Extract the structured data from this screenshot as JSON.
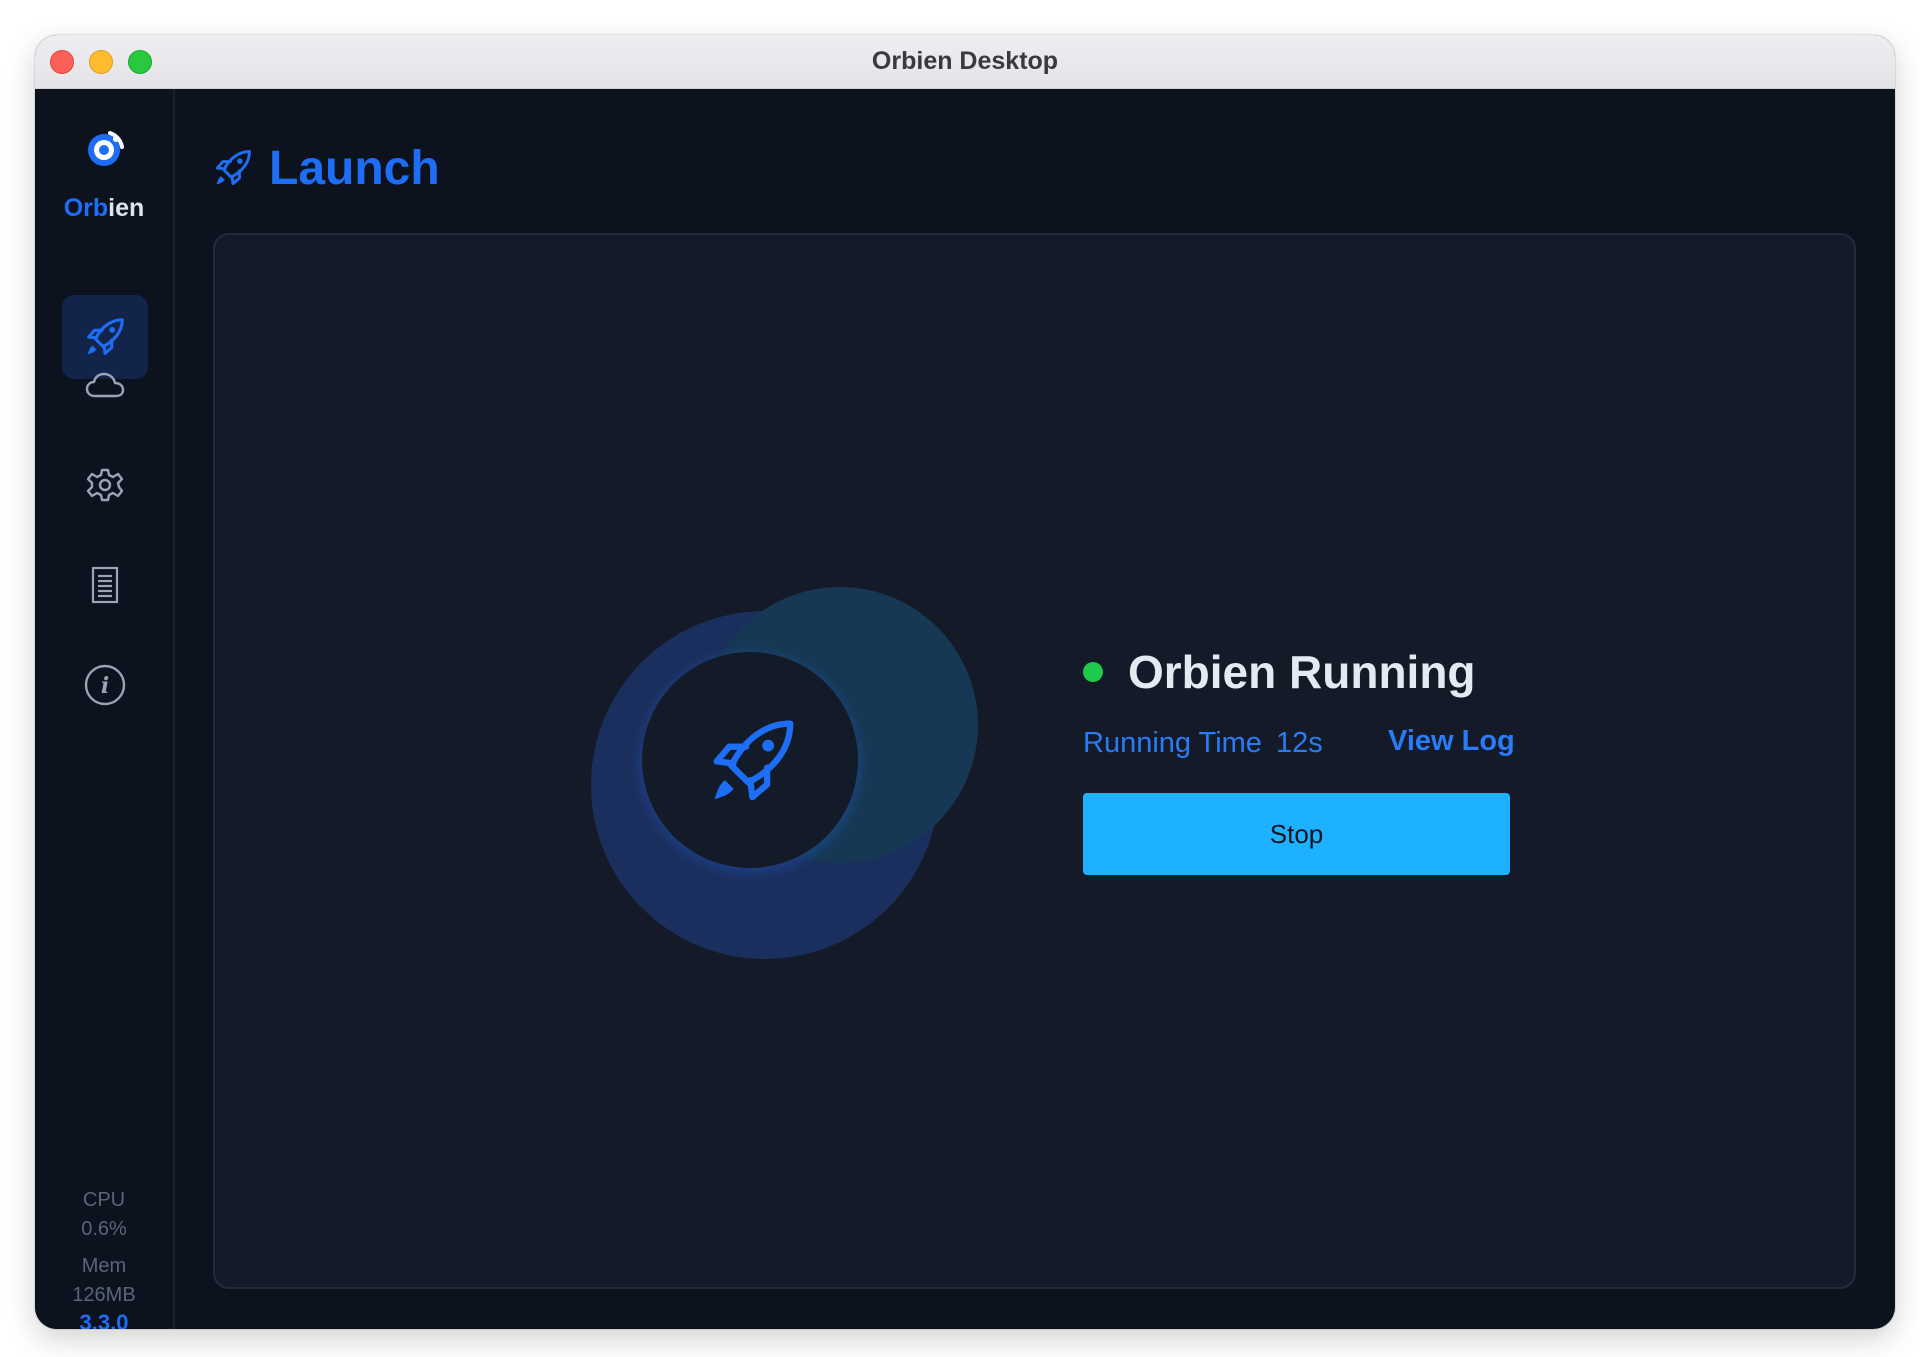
{
  "window": {
    "title": "Orbien Desktop"
  },
  "sidebar": {
    "brand_part1": "Orb",
    "brand_part2": "ien",
    "items": [
      {
        "name": "launch",
        "icon": "rocket-icon",
        "active": true
      },
      {
        "name": "cloud",
        "icon": "cloud-icon",
        "active": false
      },
      {
        "name": "settings",
        "icon": "gear-icon",
        "active": false
      },
      {
        "name": "logs",
        "icon": "document-icon",
        "active": false
      },
      {
        "name": "about",
        "icon": "info-icon",
        "active": false
      }
    ],
    "cpu_label": "CPU",
    "cpu_value": "0.6%",
    "mem_label": "Mem",
    "mem_value": "126MB",
    "version": "3.3.0"
  },
  "header": {
    "title": "Launch"
  },
  "status": {
    "text": "Orbien Running",
    "running_time_label": "Running Time",
    "running_time_value": "12s",
    "view_log_label": "View Log",
    "stop_label": "Stop"
  },
  "colors": {
    "accent": "#1e6ef5",
    "status_ok": "#1ec94b",
    "stop_button": "#1eb1ff",
    "background": "#0c121e",
    "panel": "#141a27"
  }
}
